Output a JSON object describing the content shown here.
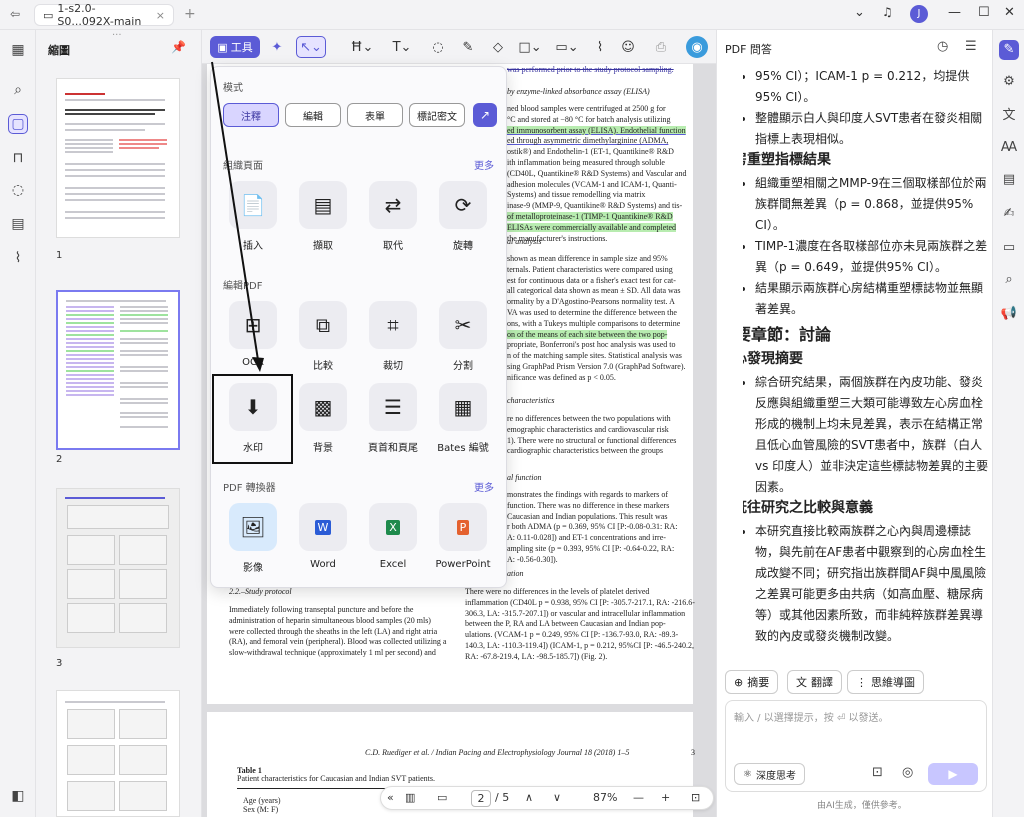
{
  "titlebar": {
    "tab_label": "1-s2.0-S0...092X-main",
    "tab_close": "×",
    "new_tab": "+",
    "avatar": "J",
    "minimize": "—",
    "maximize": "☐",
    "close": "✕",
    "chevron": "⌄",
    "bell": "🔔"
  },
  "thumbnails": {
    "header": "縮圖",
    "pages": [
      "1",
      "2",
      "3"
    ]
  },
  "toolbar": {
    "tool_label": "工具"
  },
  "popup": {
    "mode_label": "模式",
    "modes": [
      "注釋",
      "編輯",
      "表單",
      "標記密文"
    ],
    "organize_label": "組織頁面",
    "organize_more": "更多",
    "organize_tools": [
      "插入",
      "擷取",
      "取代",
      "旋轉"
    ],
    "edit_label": "編輯PDF",
    "edit_tools_row1": [
      "OCR",
      "比較",
      "裁切",
      "分割"
    ],
    "edit_tools_row2": [
      "水印",
      "背景",
      "頁首和頁尾",
      "Bates 編號"
    ],
    "convert_label": "PDF 轉換器",
    "convert_more": "更多",
    "convert_tools": [
      "影像",
      "Word",
      "Excel",
      "PowerPoint"
    ]
  },
  "document": {
    "lines_top": [
      "was performed prior to the study protocol sampling.",
      "",
      "by enzyme-linked absorbance assay (ELISA)",
      "",
      "ned blood samples were centrifuged at 2500 g for",
      "°C and stored at −80 °C for batch analysis utilizing",
      "ed immunosorbent assay (ELISA). Endothelial function",
      "ed through asymmetric dimethylarginine (ADMA,",
      "ostik®) and Endothelin-1 (ET-1, Quantikine® R&D",
      "ith inflammation being measured through soluble",
      "(CD40L, Quantikine® R&D Systems) and Vascular and",
      "adhesion molecules (VCAM-1 and ICAM-1, Quanti-",
      "Systems) and tissue remodelling via matrix",
      "inase-9 (MMP-9, Quantikine® R&D Systems) and tis-",
      "of metalloproteinase-1 (TIMP-1 Quantikine® R&D",
      "ELISAs were commercially available and completed",
      "the manufacturer's instructions."
    ],
    "section_stat": "al analysis",
    "lines_stat": [
      "shown as mean difference in sample size and 95%",
      "ternals. Patient characteristics were compared using",
      "est for continuous data or a fisher's exact test for cat-",
      "all categorical data shown as mean ± SD. All data was",
      "ormality by a D'Agostino-Pearsons normality test. A",
      "VA was used to determine the difference between the",
      "ons, with a Tukeys multiple comparisons to determine",
      "on of the means of each site between the two pop-",
      "propriate, Bonferroni's post hoc analysis was used to",
      "n of the matching sample sites. Statistical analysis was",
      "sing GraphPad Prism Version 7.0 (GraphPad Software).",
      "nificance was defined as p < 0.05."
    ],
    "section_char": "characteristics",
    "lines_char": [
      "re no differences between the two populations with",
      "emographic characteristics and cardiovascular risk",
      "1). There were no structural or functional differences",
      "cardiographic characteristics between the groups"
    ],
    "section_func": "al function",
    "lines_func": [
      "monstrates the findings with regards to markers of",
      "function. There was no difference in these markers",
      "Caucasian and Indian populations. This result was",
      "r both ADMA (p = 0.369, 95% CI [P:-0.08-0.31: RA:",
      "A: 0.11-0.028]) and ET-1 concentrations and irre-",
      "ampling site (p = 0.393, 95% CI [P: -0.64-0.22, RA:",
      "A: -0.56-0.30])."
    ],
    "section_infl": "ation",
    "lines_infl": [
      "There were no differences in the levels of platelet derived",
      "inflammation (CD40L p = 0.938, 95% CI [P: -305.7-217.1, RA: -216.6-",
      "306.3, LA: -315.7-207.1]) or vascular and intracellular inflammation",
      "between the P, RA and LA between Caucasian and Indian pop-",
      "ulations. (VCAM-1 p = 0.249, 95% CI [P: -136.7-93.0, RA: -89.3-",
      "140.3, LA: -110.3-119.4]) (ICAM-1, p = 0.212, 95%CI [P: -46.5-240.2,",
      "RA: -67.8-219.4, LA: -98.5-185.7]) (Fig. 2)."
    ],
    "section_protocol": "2.2.–Study protocol",
    "lines_protocol": [
      "Immediately following transeptal puncture and before the",
      "administration of heparin simultaneous blood samples (20 mls)",
      "were collected through the sheaths in the left (LA) and right atria",
      "(RA), and femoral vein (peripheral). Blood was collected utilizing a",
      "slow-withdrawal technique (approximately 1 ml per second) and"
    ],
    "page2_header": "C.D. Ruediger et al. / Indian Pacing and Electrophysiology Journal 18 (2018) 1–5",
    "page2_num": "3",
    "table_title": "Table 1",
    "table_caption": "Patient characteristics for Caucasian and Indian SVT patients.",
    "table_rows": [
      "Age (years)",
      "Sex (M: F)"
    ]
  },
  "navbar": {
    "current_page": "2",
    "total_pages": "/ 5",
    "zoom": "87%"
  },
  "ai_pane": {
    "header": "PDF 問答",
    "content": {
      "top_bullets": [
        "95% CI）；ICAM-1 p = 0.212，均提供95% CI）。",
        "整體顯示白人與印度人SVT患者在發炎相關指標上表現相似。"
      ],
      "section1_title": "心房重塑指標結果",
      "section1_bullets": [
        "組織重塑相關之MMP-9在三個取樣部位於兩族群間無差異（p = 0.868，並提供95% CI）。",
        "TIMP-1濃度在各取樣部位亦未見兩族群之差異（p = 0.649，並提供95% CI）。",
        "結果顯示兩族群心房結構重塑標誌物並無顯著差異。"
      ],
      "chapter_title": "主要章節：討論",
      "section2_title": "核心發現摘要",
      "section2_bullets": [
        "綜合研究結果，兩個族群在內皮功能、發炎反應與組織重塑三大類可能導致左心房血栓形成的機制上均未見差異，表示在結構正常且低心血管風險的SVT患者中，族群（白人 vs 印度人）並非決定這些標誌物差異的主要因素。"
      ],
      "section3_title": "與既往研究之比較與意義",
      "section3_bullets": [
        "本研究直接比較兩族群之心內與周邊標誌物，與先前在AF患者中觀察到的心房血栓生成改變不同；研究指出族群間AF與中風風險之差異可能更多由共病（如高血壓、糖尿病等）或其他因素所致，而非純粹族群差異導致的內皮或發炎機制改變。"
      ]
    },
    "quick_actions": [
      "摘要",
      "翻譯",
      "思維導圖"
    ],
    "chat_placeholder": "輸入 / 以選擇提示，按 ⏎ 以發送。",
    "think_label": "深度思考",
    "disclaimer": "由AI生成，僅供參考。"
  },
  "colors": {
    "accent": "#5b5bd6",
    "highlight_green": "#b8ecb0",
    "strike_purple": "#3a35a0"
  }
}
